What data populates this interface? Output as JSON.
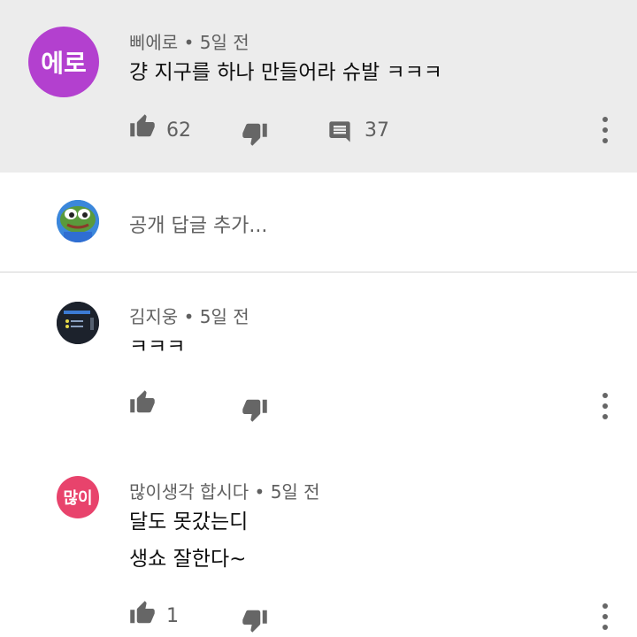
{
  "top_comment": {
    "avatar_text": "에로",
    "avatar_color": "#b340cf",
    "author": "삐에로",
    "time": "5일 전",
    "text": "걍 지구를 하나 만들어라 슈발 ㅋㅋㅋ",
    "likes": "62",
    "replies": "37"
  },
  "reply_box": {
    "placeholder": "공개 답글 추가..."
  },
  "replies": [
    {
      "author": "김지웅",
      "time": "5일 전",
      "text_lines": [
        "ㅋㅋㅋ"
      ],
      "likes": ""
    },
    {
      "avatar_text": "많이",
      "avatar_color": "#e8436c",
      "author": "많이생각 합시다",
      "time": "5일 전",
      "text_lines": [
        "달도 못갔는디",
        "생쇼 잘한다~"
      ],
      "likes": "1"
    }
  ],
  "separator": "•",
  "colors": {
    "highlight_bg": "#ececec",
    "icon_gray": "#666666",
    "meta_text": "#606060"
  }
}
